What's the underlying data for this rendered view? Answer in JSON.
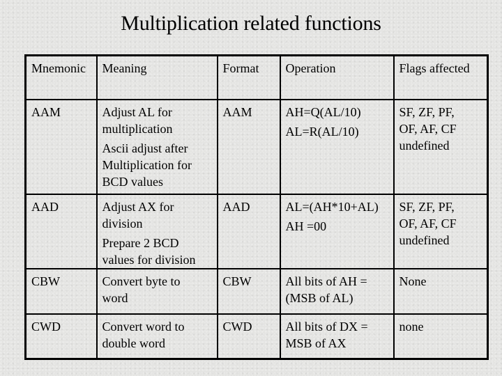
{
  "title": "Multiplication related functions",
  "table": {
    "headers": [
      "Mnemonic",
      "Meaning",
      "Format",
      "Operation",
      "Flags affected"
    ],
    "rows": [
      {
        "mnemonic": "AAM",
        "meaning": [
          "Adjust AL for",
          "multiplication"
        ],
        "meaning_extra": [
          "Ascii adjust after",
          "Multiplication for",
          "BCD values"
        ],
        "format": "AAM",
        "operation": [
          "AH=Q(AL/10)",
          "AL=R(AL/10)"
        ],
        "flags": [
          "SF, ZF, PF,",
          "OF, AF, CF",
          "undefined"
        ]
      },
      {
        "mnemonic": "AAD",
        "meaning": [
          "Adjust AX for",
          "division"
        ],
        "meaning_extra": [
          "Prepare 2 BCD",
          "values for division"
        ],
        "format": "AAD",
        "operation": [
          "AL=(AH*10+AL)",
          "AH =00"
        ],
        "flags": [
          "SF, ZF, PF,",
          "OF, AF, CF",
          "undefined"
        ]
      },
      {
        "mnemonic": "CBW",
        "meaning": [
          "Convert byte to",
          "word"
        ],
        "format": "CBW",
        "operation": [
          "All bits of AH =",
          "(MSB of AL)"
        ],
        "flags": [
          "None"
        ]
      },
      {
        "mnemonic": "CWD",
        "meaning": [
          "Convert word to",
          "double word"
        ],
        "format": "CWD",
        "operation": [
          "All bits of DX =",
          "MSB of AX"
        ],
        "flags": [
          "none"
        ]
      }
    ]
  }
}
